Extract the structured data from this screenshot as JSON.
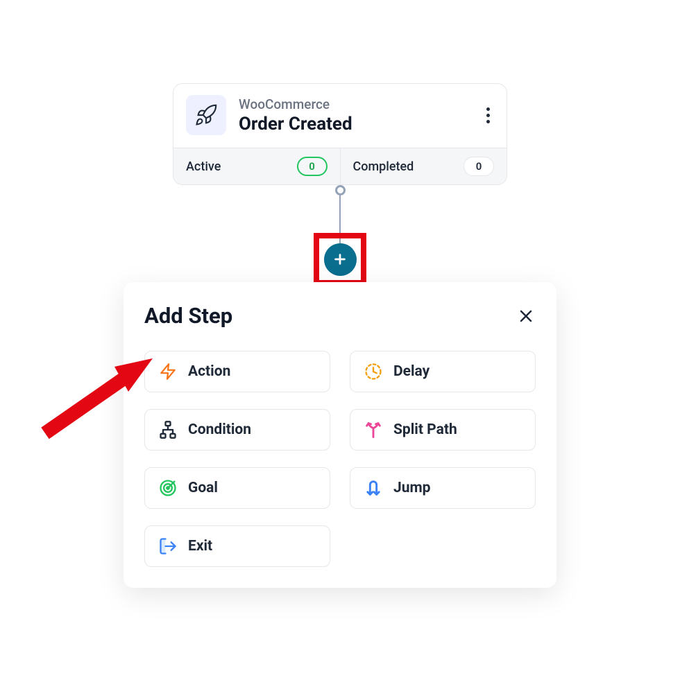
{
  "trigger": {
    "source": "WooCommerce",
    "event": "Order Created",
    "stats": {
      "active_label": "Active",
      "active_count": "0",
      "completed_label": "Completed",
      "completed_count": "0"
    }
  },
  "panel": {
    "title": "Add Step",
    "steps": [
      {
        "label": "Action",
        "icon": "lightning",
        "color": "#f97316"
      },
      {
        "label": "Delay",
        "icon": "clock-dashed",
        "color": "#f59e0b"
      },
      {
        "label": "Condition",
        "icon": "sitemap",
        "color": "#1f2937"
      },
      {
        "label": "Split Path",
        "icon": "split",
        "color": "#ec4899"
      },
      {
        "label": "Goal",
        "icon": "target",
        "color": "#22c55e"
      },
      {
        "label": "Jump",
        "icon": "jump",
        "color": "#3b82f6"
      },
      {
        "label": "Exit",
        "icon": "exit",
        "color": "#3b82f6"
      }
    ]
  }
}
